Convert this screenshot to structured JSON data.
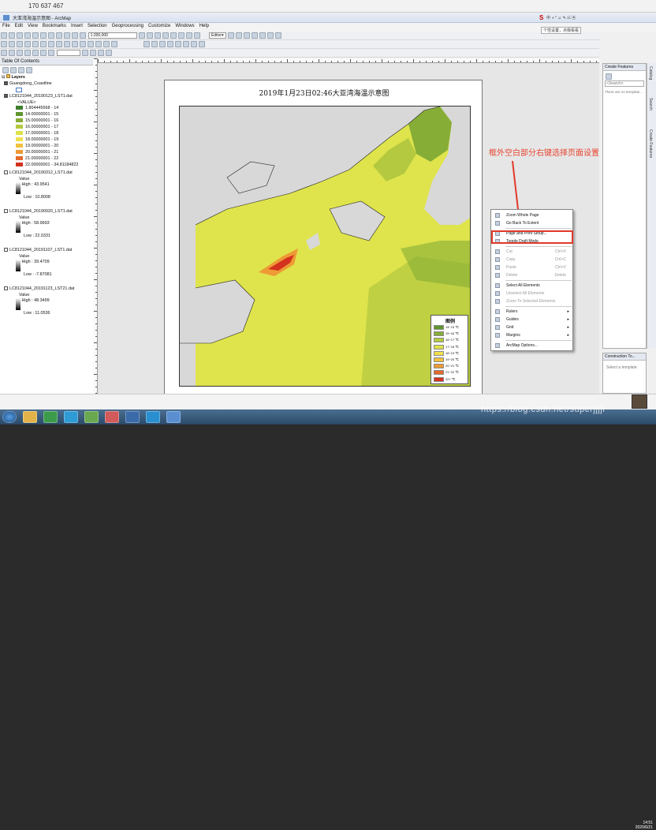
{
  "top_bar": {
    "title": "170 637 467"
  },
  "window": {
    "title": "大亚湾海温示意图 - ArcMap"
  },
  "menu": [
    "File",
    "Edit",
    "View",
    "Bookmarks",
    "Insert",
    "Selection",
    "Geoprocessing",
    "Customize",
    "Windows",
    "Help"
  ],
  "toolbar": {
    "scale": "1:200,000",
    "editor": "Editor▾"
  },
  "tray": {
    "tooltip": "个性设置，点我看看"
  },
  "toc": {
    "title": "Table Of Contents",
    "root": "Layers",
    "layers": [
      {
        "name": "Guangdong_Coastline",
        "checked": true
      },
      {
        "name": "LC8121044_20190123_LST1.dat",
        "checked": true,
        "field": "<VALUE>",
        "classes": [
          {
            "label": "1.804445568 - 14",
            "color": "#3f7f2e"
          },
          {
            "label": "14.00000001 - 15",
            "color": "#5f962f"
          },
          {
            "label": "15.00000001 - 16",
            "color": "#86ad36"
          },
          {
            "label": "16.00000001 - 17",
            "color": "#b4c93f"
          },
          {
            "label": "17.00000001 - 18",
            "color": "#dde24a"
          },
          {
            "label": "18.00000001 - 19",
            "color": "#f1e04a"
          },
          {
            "label": "19.00000001 - 20",
            "color": "#f3c140"
          },
          {
            "label": "20.00000001 - 21",
            "color": "#ee9a35"
          },
          {
            "label": "21.00000001 - 22",
            "color": "#e46a2a"
          },
          {
            "label": "22.00000001 - 34.81184822",
            "color": "#d3321f"
          }
        ]
      },
      {
        "name": "LC8121044_20190312_LST1.dat",
        "checked": false,
        "value": "Value",
        "high": "High : 43.9541",
        "low": "Low : 10.8008"
      },
      {
        "name": "LC8121044_20190920_LST1.dat",
        "checked": false,
        "value": "Value",
        "high": "High : 58.9693",
        "low": "Low : 22.0331"
      },
      {
        "name": "LC8121044_20191107_LST1.dat",
        "checked": false,
        "value": "Value",
        "high": "High : 39.4709",
        "low": "Low : -7.87081"
      },
      {
        "name": "LC8121044_20191123_LST21.dat",
        "checked": false,
        "value": "Value",
        "high": "High : 48.3499",
        "low": "Low : 11.0536"
      }
    ]
  },
  "layout": {
    "map_title": "2019年1月23日02:46大亚湾海温示意图",
    "legend_title": "图例",
    "legend_items": [
      {
        "label": "14~15 ℃",
        "color": "#5f962f"
      },
      {
        "label": "15~16 ℃",
        "color": "#86ad36"
      },
      {
        "label": "16~17 ℃",
        "color": "#b4c93f"
      },
      {
        "label": "17~18 ℃",
        "color": "#dde24a"
      },
      {
        "label": "18~19 ℃",
        "color": "#f1e04a"
      },
      {
        "label": "19~20 ℃",
        "color": "#f3c140"
      },
      {
        "label": "20~21 ℃",
        "color": "#ee9a35"
      },
      {
        "label": "21~22 ℃",
        "color": "#e46a2a"
      },
      {
        "label": "22+ ℃",
        "color": "#d3321f"
      }
    ]
  },
  "annotation": "框外空白部分右键选择页面设置",
  "context_menu": [
    {
      "label": "Zoom Whole Page",
      "enabled": true
    },
    {
      "label": "Go Back To Extent",
      "enabled": true
    },
    {
      "sep": true
    },
    {
      "label": "Page and Print Setup...",
      "enabled": true,
      "highlight": true
    },
    {
      "label": "Toggle Draft Mode",
      "enabled": true
    },
    {
      "sep": true
    },
    {
      "label": "Cut",
      "shortcut": "Ctrl+X",
      "enabled": false
    },
    {
      "label": "Copy",
      "shortcut": "Ctrl+C",
      "enabled": false
    },
    {
      "label": "Paste",
      "shortcut": "Ctrl+V",
      "enabled": false
    },
    {
      "label": "Delete",
      "shortcut": "Delete",
      "enabled": false
    },
    {
      "sep": true
    },
    {
      "label": "Select All Elements",
      "enabled": true
    },
    {
      "label": "Unselect All Elements",
      "enabled": false
    },
    {
      "label": "Zoom To Selected Elements",
      "enabled": false
    },
    {
      "sep": true
    },
    {
      "label": "Rulers",
      "submenu": true,
      "enabled": true
    },
    {
      "label": "Guides",
      "submenu": true,
      "enabled": true
    },
    {
      "label": "Grid",
      "submenu": true,
      "enabled": true
    },
    {
      "label": "Margins",
      "submenu": true,
      "enabled": true
    },
    {
      "sep": true
    },
    {
      "label": "ArcMap Options...",
      "enabled": true
    }
  ],
  "create_features": {
    "title": "Create Features",
    "search": "<Search>",
    "empty": "There are no template..."
  },
  "construction_tools": {
    "title": "Construction To...",
    "hint": "Select a template."
  },
  "side_tabs": [
    "Catalog",
    "Search",
    "Create Features"
  ],
  "watermark": "https://blog.csdn.net/superjjjjl",
  "clock": {
    "time": "14:51",
    "date": "2020/6/21"
  }
}
